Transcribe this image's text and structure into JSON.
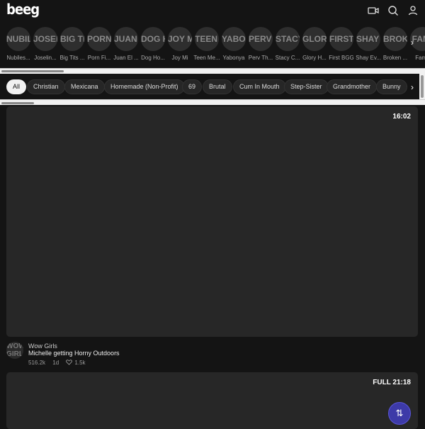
{
  "header": {
    "logo": "beeg",
    "icons": [
      "video-camera-icon",
      "search-icon",
      "user-icon"
    ]
  },
  "channels": [
    {
      "initials": "NUBILES",
      "name": "Nubiles..."
    },
    {
      "initials": "JOSELI",
      "name": "Joselin..."
    },
    {
      "initials": "BIG TITS",
      "name": "Big Tits ..."
    },
    {
      "initials": "PORN F",
      "name": "Porn Fi..."
    },
    {
      "initials": "JUAN E",
      "name": "Juan El ..."
    },
    {
      "initials": "DOG HO",
      "name": "Dog Ho..."
    },
    {
      "initials": "JOY MI",
      "name": "Joy Mi"
    },
    {
      "initials": "TEEN M",
      "name": "Teen Me..."
    },
    {
      "initials": "YABON",
      "name": "Yabonya"
    },
    {
      "initials": "PERV T",
      "name": "Perv Th..."
    },
    {
      "initials": "STACY",
      "name": "Stacy C..."
    },
    {
      "initials": "GLORY",
      "name": "Glory H..."
    },
    {
      "initials": "FIRST B",
      "name": "First BGG"
    },
    {
      "initials": "SHAY E",
      "name": "Shay Ev..."
    },
    {
      "initials": "BROKE",
      "name": "Broken ..."
    },
    {
      "initials": "FAMI",
      "name": "Famil"
    }
  ],
  "channel_next": "›",
  "tags": [
    "All",
    "Christian",
    "Mexicana",
    "Homemade (Non-Profit)",
    "69",
    "Brutal",
    "Cum In Mouth",
    "Step-Sister",
    "Grandmother",
    "Bunny"
  ],
  "tag_next": "›",
  "videos": [
    {
      "duration": "16:02",
      "avatar_text": "WOW GIRL",
      "channel": "Wow Girls",
      "title": "Michelle getting Horny Outdoors",
      "views": "516.2k",
      "age": "1d",
      "likes": "1.5k"
    },
    {
      "duration": "FULL 21:18"
    }
  ],
  "fab_label": "⇅"
}
